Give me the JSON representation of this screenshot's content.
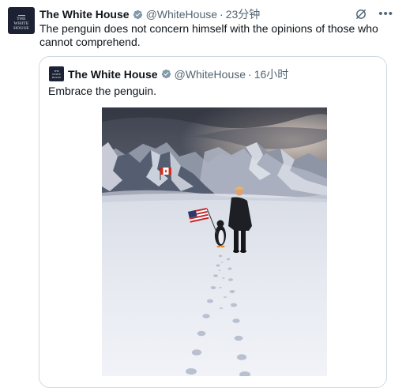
{
  "tweet": {
    "avatar_text": [
      "THE",
      "WHITE",
      "HOUSE"
    ],
    "name": "The White House",
    "handle": "@WhiteHouse",
    "separator": "·",
    "time": "23分钟",
    "text": "The penguin does not concern himself with the opinions of those who cannot comprehend.",
    "verified_color": "#829aab",
    "icons": {
      "verified": "verified-badge-icon",
      "grok": "grok-icon",
      "more": "more-icon"
    }
  },
  "quote": {
    "name": "The White House",
    "handle": "@WhiteHouse",
    "separator": "·",
    "time": "16小时",
    "text": "Embrace the penguin.",
    "image": {
      "subject": "photo-snowfield-penguin-flag",
      "flags": [
        "canada-flag",
        "us-flag"
      ]
    }
  }
}
